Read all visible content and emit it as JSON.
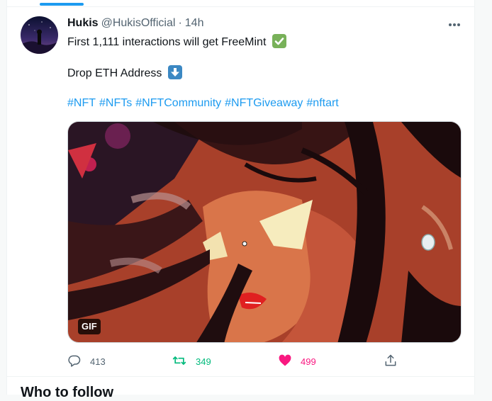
{
  "tweet": {
    "display_name": "Hukis",
    "handle": "@HukisOfficial",
    "separator": "·",
    "time": "14h",
    "line1": "First 1,111 interactions will get FreeMint",
    "line2": "Drop ETH Address",
    "hashtags": [
      "#NFT",
      "#NFTs",
      "#NFTCommunity",
      "#NFTGiveaway",
      "#nftart"
    ],
    "media_badge": "GIF"
  },
  "actions": {
    "reply_count": "413",
    "retweet_count": "349",
    "like_count": "499"
  },
  "section": {
    "heading": "Who to follow"
  },
  "colors": {
    "accent": "#1d9bf0",
    "retweet": "#00ba7c",
    "like": "#f91880",
    "muted": "#536471"
  },
  "icons": {
    "more": "more-horizontal-icon",
    "check_emoji": "check-mark-button-icon",
    "down_emoji": "down-arrow-icon",
    "reply": "reply-icon",
    "retweet": "retweet-icon",
    "like": "heart-icon",
    "share": "share-icon"
  }
}
